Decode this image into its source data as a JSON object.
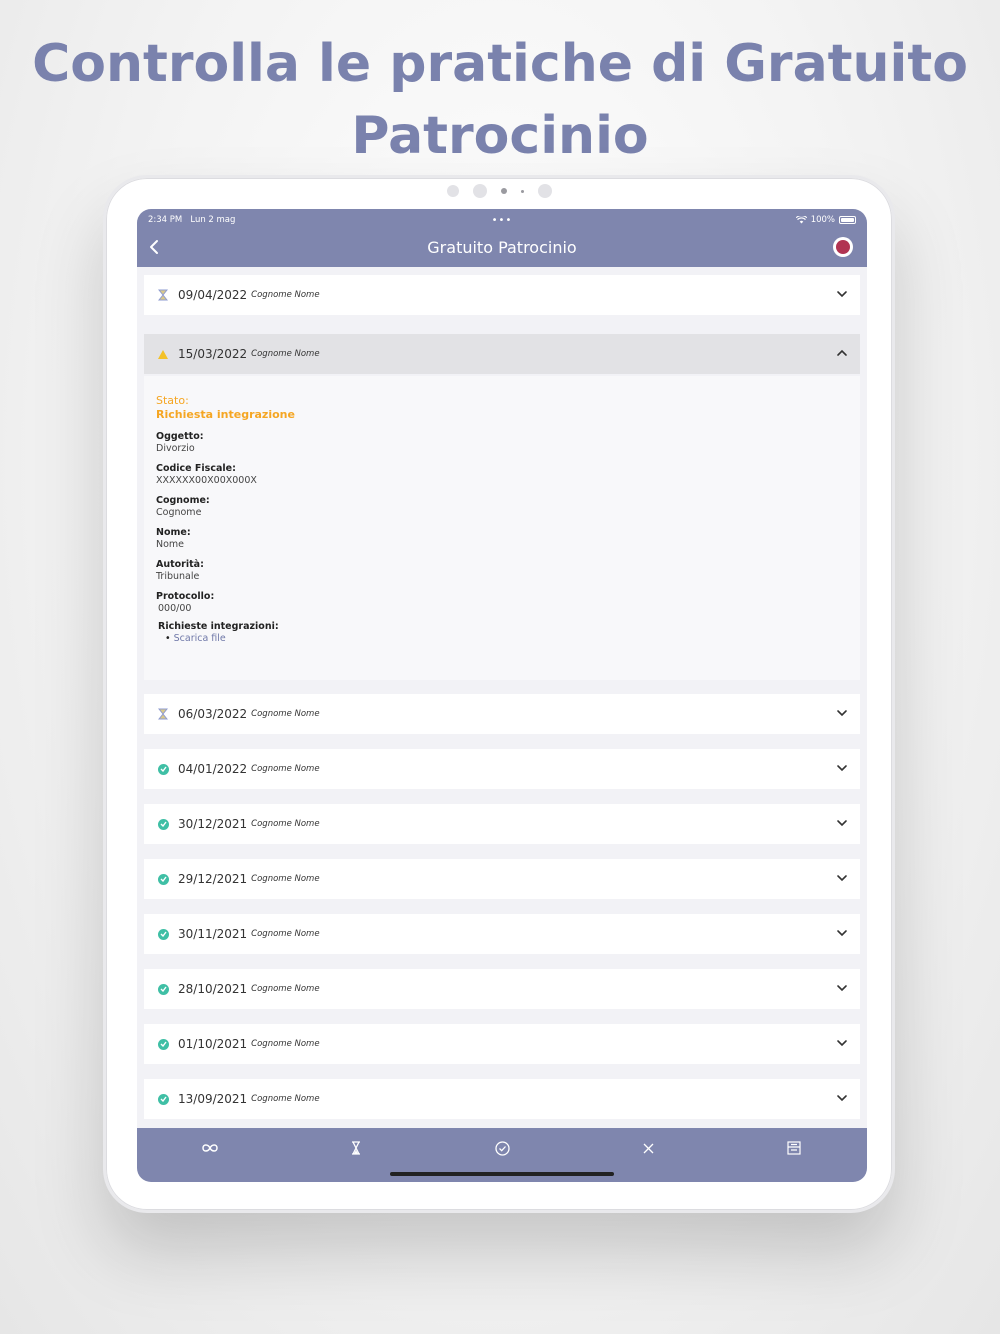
{
  "headline": "Controlla le pratiche di Gratuito Patrocinio",
  "status_bar": {
    "time": "2:34 PM",
    "date": "Lun 2 mag",
    "dots": "•••",
    "battery": "100%"
  },
  "nav": {
    "title": "Gratuito Patrocinio",
    "back_icon": "chevron-left-icon",
    "avatar_icon": "profile-avatar-icon"
  },
  "colors": {
    "accent": "#7f86ae",
    "headline": "#7a82ad",
    "success": "#3fbfa5",
    "warning": "#f3c128",
    "stato_text": "#f5a623"
  },
  "rows": [
    {
      "date": "09/04/2022",
      "name": "Cognome Nome",
      "status_icon": "hourglass-icon",
      "expanded": false
    },
    {
      "date": "15/03/2022",
      "name": "Cognome Nome",
      "status_icon": "warning-icon",
      "expanded": true
    },
    {
      "date": "06/03/2022",
      "name": "Cognome Nome",
      "status_icon": "hourglass-icon",
      "expanded": false
    },
    {
      "date": "04/01/2022",
      "name": "Cognome Nome",
      "status_icon": "check-circle-icon",
      "expanded": false
    },
    {
      "date": "30/12/2021",
      "name": "Cognome Nome",
      "status_icon": "check-circle-icon",
      "expanded": false
    },
    {
      "date": "29/12/2021",
      "name": "Cognome Nome",
      "status_icon": "check-circle-icon",
      "expanded": false
    },
    {
      "date": "30/11/2021",
      "name": "Cognome Nome",
      "status_icon": "check-circle-icon",
      "expanded": false
    },
    {
      "date": "28/10/2021",
      "name": "Cognome Nome",
      "status_icon": "check-circle-icon",
      "expanded": false
    },
    {
      "date": "01/10/2021",
      "name": "Cognome Nome",
      "status_icon": "check-circle-icon",
      "expanded": false
    },
    {
      "date": "13/09/2021",
      "name": "Cognome Nome",
      "status_icon": "check-circle-icon",
      "expanded": false
    }
  ],
  "detail": {
    "stato_label": "Stato:",
    "stato_value": "Richiesta integrazione",
    "oggetto_label": "Oggetto:",
    "oggetto_value": "Divorzio",
    "cf_label": "Codice Fiscale:",
    "cf_value": "XXXXXX00X00X000X",
    "cognome_label": "Cognome:",
    "cognome_value": "Cognome",
    "nome_label": "Nome:",
    "nome_value": "Nome",
    "autorita_label": "Autorità:",
    "autorita_value": "Tribunale",
    "protocollo_label": "Protocollo:",
    "protocollo_value": "000/00",
    "integrazioni_label": "Richieste integrazioni:",
    "integrazioni_link": "Scarica file"
  },
  "tabs": [
    {
      "icon": "infinity-icon"
    },
    {
      "icon": "hourglass-icon"
    },
    {
      "icon": "check-circle-icon"
    },
    {
      "icon": "close-icon"
    },
    {
      "icon": "archive-icon"
    }
  ]
}
